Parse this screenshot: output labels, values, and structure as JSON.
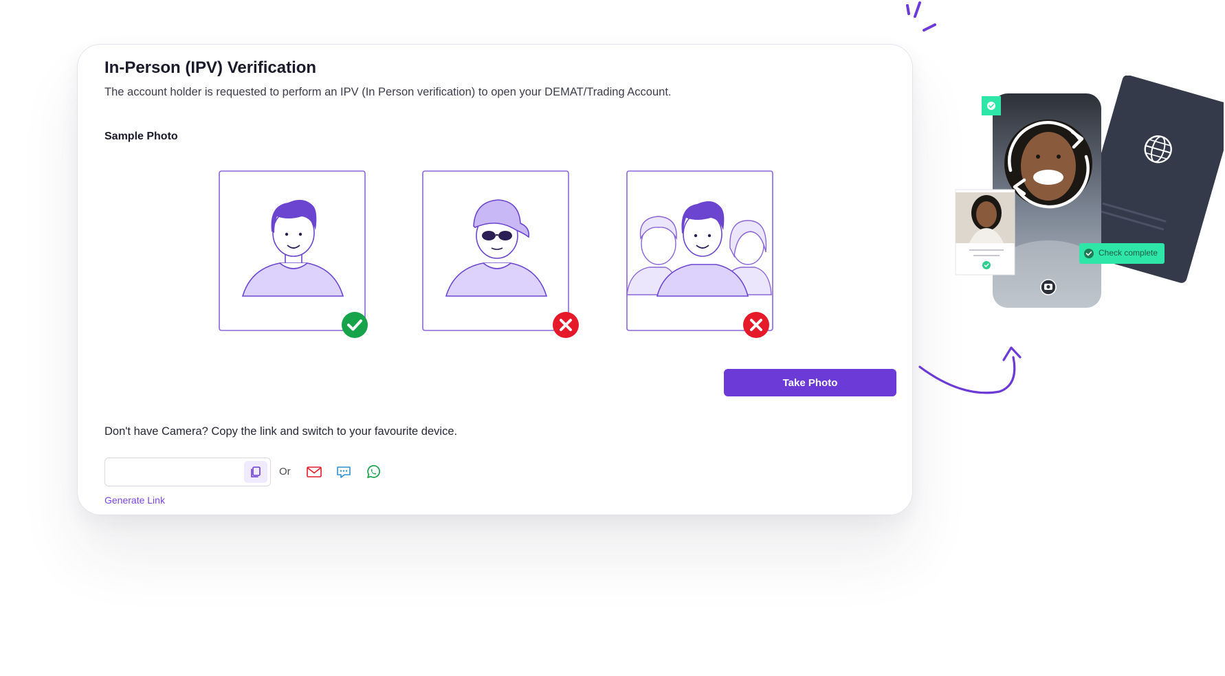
{
  "card": {
    "title": "In-Person (IPV) Verification",
    "subtitle": "The account holder is requested to perform an IPV (In Person verification) to open your DEMAT/Trading Account.",
    "sample_label": "Sample Photo",
    "samples": [
      {
        "status": "accepted",
        "badge_icon": "check-icon"
      },
      {
        "status": "rejected",
        "badge_icon": "cross-icon"
      },
      {
        "status": "rejected",
        "badge_icon": "cross-icon"
      }
    ],
    "take_photo_label": "Take Photo",
    "no_camera_text": "Don't have Camera? Copy the link and switch to your favourite device.",
    "link_input": {
      "value": "",
      "placeholder": ""
    },
    "or_text": "Or",
    "share_icons": [
      "email-icon",
      "sms-icon",
      "whatsapp-icon"
    ],
    "generate_link_label": "Generate Link"
  },
  "illustration": {
    "check_complete_label": "Check complete"
  },
  "colors": {
    "accent": "#6c3ad6",
    "accepted": "#16a34a",
    "rejected": "#e5192a",
    "teal_badge": "#2ee6a8",
    "passport": "#353a4b"
  }
}
